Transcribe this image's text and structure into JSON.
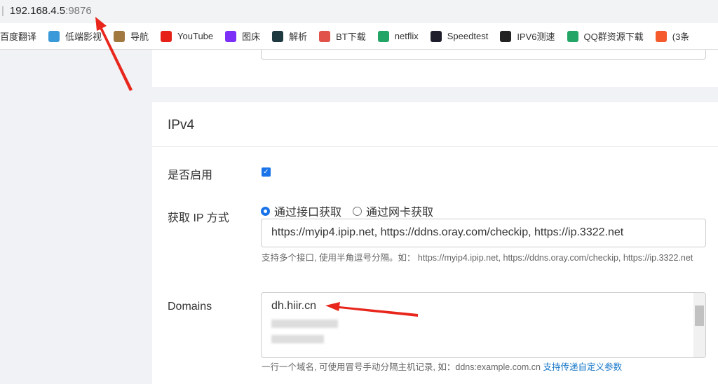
{
  "browser": {
    "address_host": "192.168.4.5",
    "address_port": ":9876",
    "bookmarks": [
      {
        "label": "百度翻译",
        "icon": "none",
        "color": ""
      },
      {
        "label": "低端影视",
        "icon": "dd-icon",
        "color": "#3a9ad9"
      },
      {
        "label": "导航",
        "icon": "owl-icon",
        "color": "#a07840"
      },
      {
        "label": "YouTube",
        "icon": "youtube-icon",
        "color": "#e62117"
      },
      {
        "label": "图床",
        "icon": "s-icon",
        "color": "#7b2ff7"
      },
      {
        "label": "解析",
        "icon": "globe-icon",
        "color": "#1e3a40"
      },
      {
        "label": "BT下载",
        "icon": "bt-icon",
        "color": "#e0524a"
      },
      {
        "label": "netflix",
        "icon": "sheet-icon",
        "color": "#23a566"
      },
      {
        "label": "Speedtest",
        "icon": "gauge-icon",
        "color": "#1d1d2b"
      },
      {
        "label": "IPV6测速",
        "icon": "clock-icon",
        "color": "#222"
      },
      {
        "label": "QQ群资源下载",
        "icon": "sheet-icon",
        "color": "#23a566"
      },
      {
        "label": "(3条",
        "icon": "c-icon",
        "color": "#f55a2c"
      }
    ]
  },
  "section": {
    "title": "IPv4",
    "enable_label": "是否启用",
    "enabled": true,
    "method_label": "获取 IP 方式",
    "method_options": [
      "通过接口获取",
      "通过网卡获取"
    ],
    "method_selected": "通过接口获取",
    "url_value": "https://myip4.ipip.net, https://ddns.oray.com/checkip, https://ip.3322.net",
    "url_help": "支持多个接口, 使用半角逗号分隔。如： https://myip4.ipip.net, https://ddns.oray.com/checkip, https://ip.3322.net",
    "domains_label": "Domains",
    "domains_first": "dh.hiir.cn",
    "domains_help": "一行一个域名, 可使用冒号手动分隔主机记录, 如：ddns:example.com.cn ",
    "domains_link": "支持传递自定义参数"
  }
}
